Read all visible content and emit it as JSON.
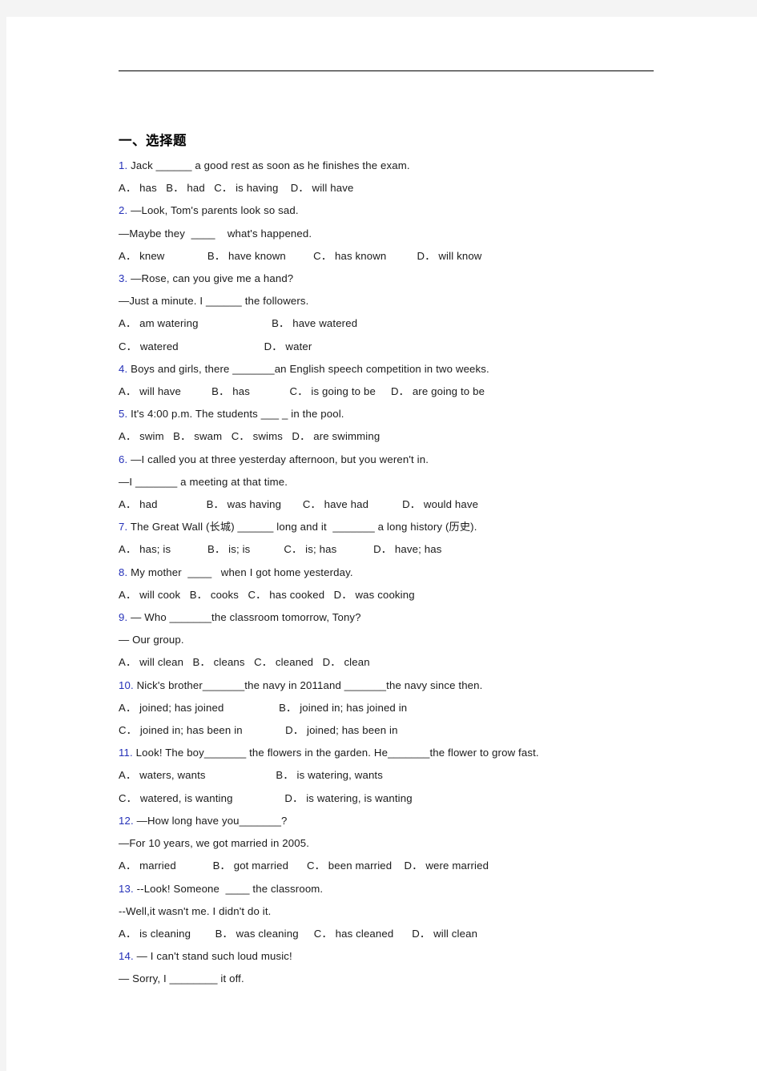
{
  "page": {
    "background_color": "#f4f4f4",
    "paper_color": "#ffffff",
    "has_header_rule": true,
    "number_color": "#2430b8",
    "text_color": "#1a1a1a"
  },
  "section": {
    "heading": "一、选择题"
  },
  "questions": [
    {
      "num": "1.",
      "stem": " Jack ______ a good rest as soon as he finishes the exam.",
      "extra_lines": [],
      "options_lines": [
        "A． has   B． had   C． is having    D． will have"
      ]
    },
    {
      "num": "2.",
      "stem": " —Look, Tom's parents look so sad.",
      "extra_lines": [
        "—Maybe they  ____    what's happened."
      ],
      "options_lines": [
        "A． knew              B． have known         C． has known          D． will know"
      ]
    },
    {
      "num": "3.",
      "stem": " —Rose, can you give me a hand?",
      "extra_lines": [
        "—Just a minute. I ______ the followers."
      ],
      "options_lines": [
        "A． am watering                        B． have watered",
        "C． watered                            D． water"
      ]
    },
    {
      "num": "4.",
      "stem": " Boys and girls, there _______an English speech competition in two weeks.",
      "extra_lines": [],
      "options_lines": [
        "A． will have          B． has             C． is going to be     D． are going to be"
      ]
    },
    {
      "num": "5.",
      "stem": " It's 4:00 p.m. The students ___ _ in the pool.",
      "extra_lines": [],
      "options_lines": [
        "A． swim   B． swam   C． swims   D． are swimming"
      ]
    },
    {
      "num": "6.",
      "stem": " —I called you at three yesterday afternoon, but you weren't in.",
      "extra_lines": [
        "—I _______ a meeting at that time."
      ],
      "options_lines": [
        "A． had                B． was having       C． have had           D． would have"
      ]
    },
    {
      "num": "7.",
      "stem": " The Great Wall (长城) ______ long and it  _______ a long history (历史).",
      "extra_lines": [],
      "options_lines": [
        "A． has; is            B． is; is           C． is; has            D． have; has"
      ]
    },
    {
      "num": "8.",
      "stem": " My mother  ____   when I got home yesterday.",
      "extra_lines": [],
      "options_lines": [
        "A． will cook   B． cooks   C． has cooked   D． was cooking"
      ]
    },
    {
      "num": "9.",
      "stem": " — Who _______the classroom tomorrow, Tony?",
      "extra_lines": [
        "— Our group."
      ],
      "options_lines": [
        "A． will clean   B． cleans   C． cleaned   D． clean"
      ]
    },
    {
      "num": "10.",
      "stem": " Nick's brother_______the navy in 2011and _______the navy since then.",
      "extra_lines": [],
      "options_lines": [
        "A． joined; has joined                  B． joined in; has joined in",
        "C． joined in; has been in              D． joined; has been in"
      ]
    },
    {
      "num": "11.",
      "stem": " Look! The boy_______ the flowers in the garden. He_______the flower to grow fast.",
      "extra_lines": [],
      "options_lines": [
        "A． waters, wants                       B． is watering, wants",
        "C． watered, is wanting                 D． is watering, is wanting"
      ]
    },
    {
      "num": "12.",
      "stem": " —How long have you_______?",
      "extra_lines": [
        "—For 10 years, we got married in 2005."
      ],
      "options_lines": [
        "A． married            B． got married      C． been married    D． were married"
      ]
    },
    {
      "num": "13.",
      "stem": " --Look! Someone  ____ the classroom.",
      "extra_lines": [
        "--Well,it wasn't me. I didn't do it."
      ],
      "options_lines": [
        "A． is cleaning        B． was cleaning     C． has cleaned      D． will clean"
      ]
    },
    {
      "num": "14.",
      "stem": " — I can't stand such loud music!",
      "extra_lines": [
        "— Sorry, I ________ it off."
      ],
      "options_lines": []
    }
  ]
}
